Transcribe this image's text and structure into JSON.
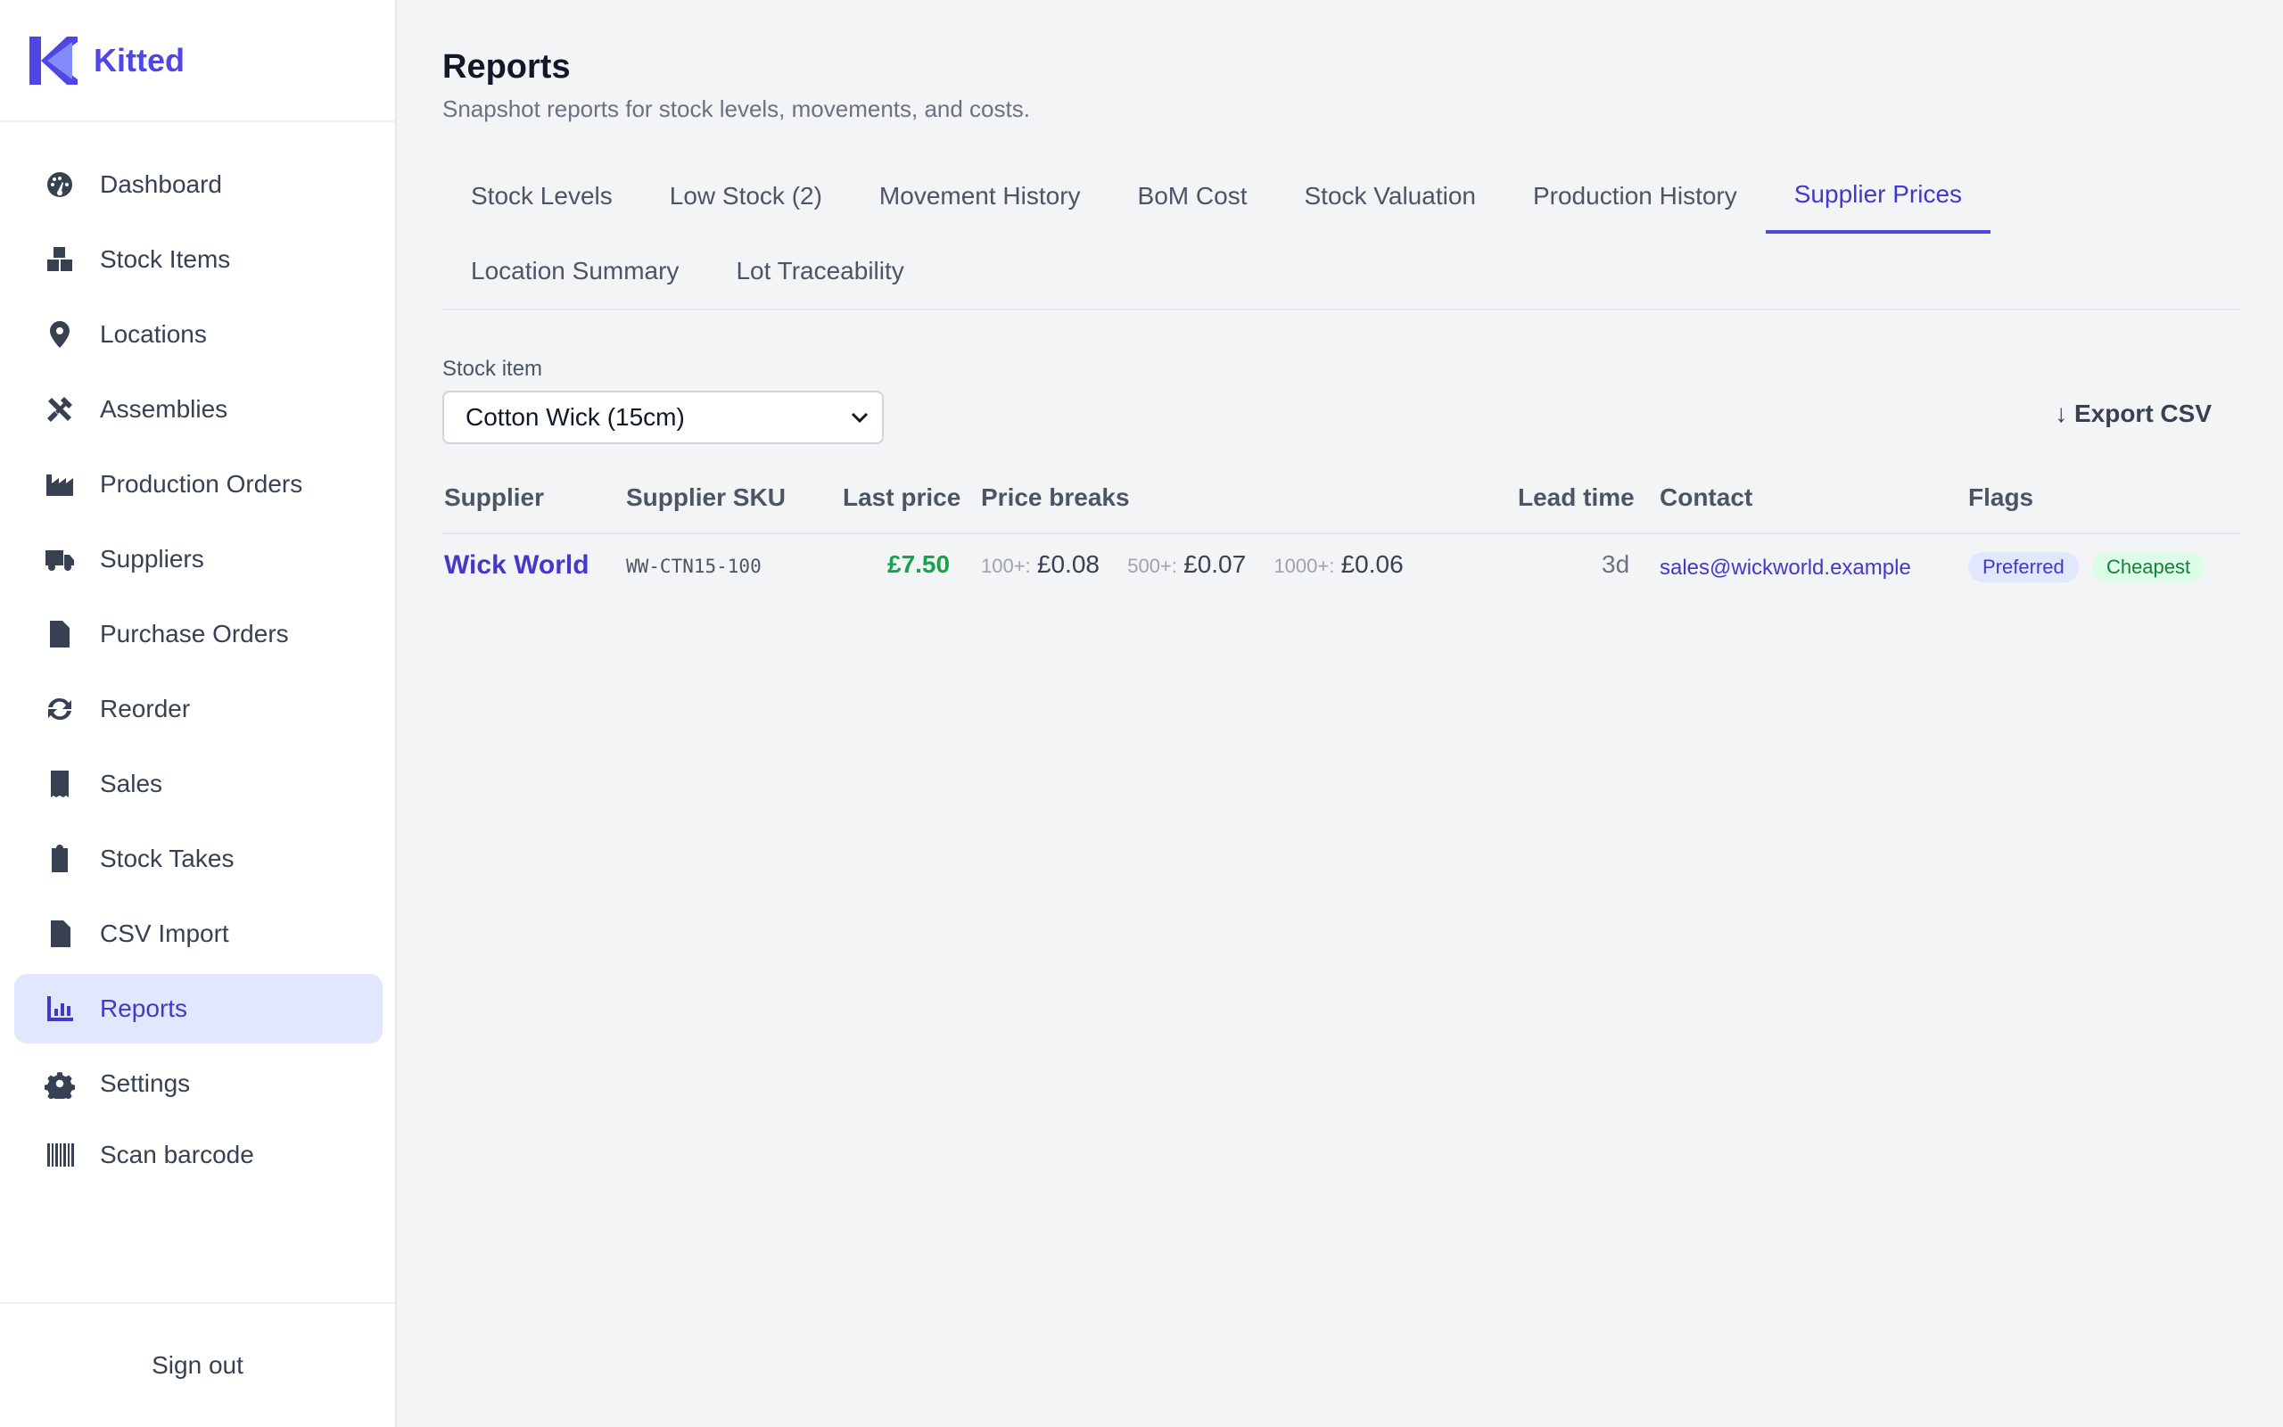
{
  "brand": {
    "name": "Kitted",
    "logo_color": "#4f46e5"
  },
  "sidebar": {
    "items": [
      {
        "label": "Dashboard",
        "icon": "gauge-icon",
        "active": false
      },
      {
        "label": "Stock Items",
        "icon": "boxes-icon",
        "active": false
      },
      {
        "label": "Locations",
        "icon": "map-pin-icon",
        "active": false
      },
      {
        "label": "Assemblies",
        "icon": "tools-icon",
        "active": false
      },
      {
        "label": "Production Orders",
        "icon": "factory-icon",
        "active": false
      },
      {
        "label": "Suppliers",
        "icon": "truck-icon",
        "active": false
      },
      {
        "label": "Purchase Orders",
        "icon": "file-icon",
        "active": false
      },
      {
        "label": "Reorder",
        "icon": "refresh-icon",
        "active": false
      },
      {
        "label": "Sales",
        "icon": "receipt-icon",
        "active": false
      },
      {
        "label": "Stock Takes",
        "icon": "clipboard-check-icon",
        "active": false
      },
      {
        "label": "CSV Import",
        "icon": "file-import-icon",
        "active": false
      },
      {
        "label": "Reports",
        "icon": "chart-icon",
        "active": true
      },
      {
        "label": "Settings",
        "icon": "gear-icon",
        "active": false
      },
      {
        "label": "Scan barcode",
        "icon": "barcode-icon",
        "active": false
      }
    ],
    "signout_label": "Sign out"
  },
  "page": {
    "title": "Reports",
    "subtitle": "Snapshot reports for stock levels, movements, and costs."
  },
  "tabs": [
    {
      "label": "Stock Levels",
      "active": false
    },
    {
      "label": "Low Stock (2)",
      "active": false
    },
    {
      "label": "Movement History",
      "active": false
    },
    {
      "label": "BoM Cost",
      "active": false
    },
    {
      "label": "Stock Valuation",
      "active": false
    },
    {
      "label": "Production History",
      "active": false
    },
    {
      "label": "Supplier Prices",
      "active": true
    },
    {
      "label": "Location Summary",
      "active": false
    },
    {
      "label": "Lot Traceability",
      "active": false
    }
  ],
  "filters": {
    "stock_item_label": "Stock item",
    "stock_item_value": "Cotton Wick (15cm)",
    "export_label": "↓ Export CSV"
  },
  "table": {
    "columns": [
      "Supplier",
      "Supplier SKU",
      "Last price",
      "Price breaks",
      "Lead time",
      "Contact",
      "Flags"
    ],
    "rows": [
      {
        "supplier": "Wick World",
        "sku": "WW-CTN15-100",
        "last_price": "£7.50",
        "price_breaks": [
          {
            "qty": "100+:",
            "price": "£0.08"
          },
          {
            "qty": "500+:",
            "price": "£0.07"
          },
          {
            "qty": "1000+:",
            "price": "£0.06"
          }
        ],
        "lead_time": "3d",
        "contact": "sales@wickworld.example",
        "flags": [
          "Preferred",
          "Cheapest"
        ]
      }
    ]
  },
  "colors": {
    "accent": "#4f46e5",
    "price_green": "#16a34a",
    "active_bg": "#e0e7ff"
  }
}
